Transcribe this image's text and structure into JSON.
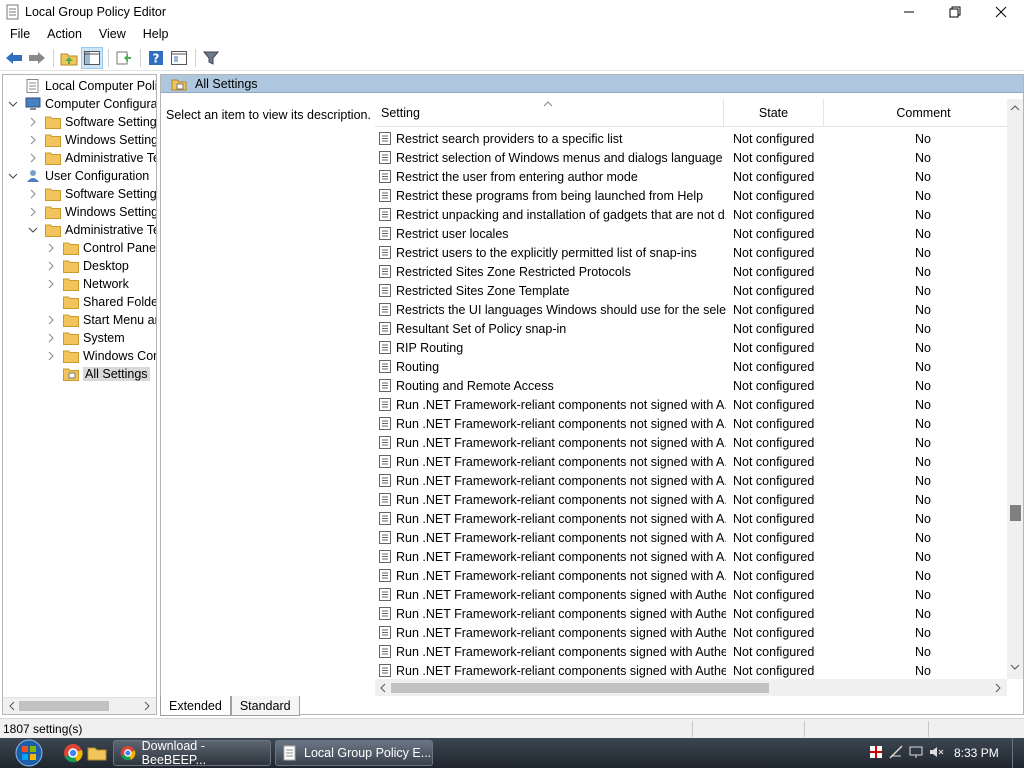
{
  "window": {
    "title": "Local Group Policy Editor"
  },
  "menu": [
    "File",
    "Action",
    "View",
    "Help"
  ],
  "tree": {
    "items": [
      {
        "label": "Local Computer Policy",
        "level": 0,
        "expander": "",
        "icon": "policy-icon"
      },
      {
        "label": "Computer Configuration",
        "level": 0,
        "expander": "open",
        "icon": "computer-icon"
      },
      {
        "label": "Software Settings",
        "level": 1,
        "expander": "closed",
        "icon": "folder-icon"
      },
      {
        "label": "Windows Settings",
        "level": 1,
        "expander": "closed",
        "icon": "folder-icon"
      },
      {
        "label": "Administrative Templates",
        "level": 1,
        "expander": "closed",
        "icon": "folder-icon"
      },
      {
        "label": "User Configuration",
        "level": 0,
        "expander": "open",
        "icon": "user-icon"
      },
      {
        "label": "Software Settings",
        "level": 1,
        "expander": "closed",
        "icon": "folder-icon"
      },
      {
        "label": "Windows Settings",
        "level": 1,
        "expander": "closed",
        "icon": "folder-icon"
      },
      {
        "label": "Administrative Templates",
        "level": 1,
        "expander": "open",
        "icon": "folder-icon"
      },
      {
        "label": "Control Panel",
        "level": 2,
        "expander": "closed",
        "icon": "folder-icon"
      },
      {
        "label": "Desktop",
        "level": 2,
        "expander": "closed",
        "icon": "folder-icon"
      },
      {
        "label": "Network",
        "level": 2,
        "expander": "closed",
        "icon": "folder-icon"
      },
      {
        "label": "Shared Folders",
        "level": 2,
        "expander": "",
        "icon": "folder-icon"
      },
      {
        "label": "Start Menu and Taskbar",
        "level": 2,
        "expander": "closed",
        "icon": "folder-icon"
      },
      {
        "label": "System",
        "level": 2,
        "expander": "closed",
        "icon": "folder-icon"
      },
      {
        "label": "Windows Components",
        "level": 2,
        "expander": "closed",
        "icon": "folder-icon"
      },
      {
        "label": "All Settings",
        "level": 2,
        "expander": "",
        "icon": "all-settings-icon",
        "selected": true
      }
    ]
  },
  "pane": {
    "header": "All Settings",
    "description": "Select an item to view its description."
  },
  "list": {
    "columns": {
      "setting": "Setting",
      "state": "State",
      "comment": "Comment"
    },
    "rows": [
      {
        "name": "Restrict search providers to a specific list",
        "state": "Not configured",
        "comment": "No"
      },
      {
        "name": "Restrict selection of Windows menus and dialogs language",
        "state": "Not configured",
        "comment": "No"
      },
      {
        "name": "Restrict the user from entering author mode",
        "state": "Not configured",
        "comment": "No"
      },
      {
        "name": "Restrict these programs from being launched from Help",
        "state": "Not configured",
        "comment": "No"
      },
      {
        "name": "Restrict unpacking and installation of gadgets that are not d...",
        "state": "Not configured",
        "comment": "No"
      },
      {
        "name": "Restrict user locales",
        "state": "Not configured",
        "comment": "No"
      },
      {
        "name": "Restrict users to the explicitly permitted list of snap-ins",
        "state": "Not configured",
        "comment": "No"
      },
      {
        "name": "Restricted Sites Zone Restricted Protocols",
        "state": "Not configured",
        "comment": "No"
      },
      {
        "name": "Restricted Sites Zone Template",
        "state": "Not configured",
        "comment": "No"
      },
      {
        "name": "Restricts the UI languages Windows should use for the selec...",
        "state": "Not configured",
        "comment": "No"
      },
      {
        "name": "Resultant Set of Policy snap-in",
        "state": "Not configured",
        "comment": "No"
      },
      {
        "name": "RIP Routing",
        "state": "Not configured",
        "comment": "No"
      },
      {
        "name": "Routing",
        "state": "Not configured",
        "comment": "No"
      },
      {
        "name": "Routing and Remote Access",
        "state": "Not configured",
        "comment": "No"
      },
      {
        "name": "Run .NET Framework-reliant components not signed with A...",
        "state": "Not configured",
        "comment": "No"
      },
      {
        "name": "Run .NET Framework-reliant components not signed with A...",
        "state": "Not configured",
        "comment": "No"
      },
      {
        "name": "Run .NET Framework-reliant components not signed with A...",
        "state": "Not configured",
        "comment": "No"
      },
      {
        "name": "Run .NET Framework-reliant components not signed with A...",
        "state": "Not configured",
        "comment": "No"
      },
      {
        "name": "Run .NET Framework-reliant components not signed with A...",
        "state": "Not configured",
        "comment": "No"
      },
      {
        "name": "Run .NET Framework-reliant components not signed with A...",
        "state": "Not configured",
        "comment": "No"
      },
      {
        "name": "Run .NET Framework-reliant components not signed with A...",
        "state": "Not configured",
        "comment": "No"
      },
      {
        "name": "Run .NET Framework-reliant components not signed with A...",
        "state": "Not configured",
        "comment": "No"
      },
      {
        "name": "Run .NET Framework-reliant components not signed with A...",
        "state": "Not configured",
        "comment": "No"
      },
      {
        "name": "Run .NET Framework-reliant components not signed with A...",
        "state": "Not configured",
        "comment": "No"
      },
      {
        "name": "Run .NET Framework-reliant components signed with Authe...",
        "state": "Not configured",
        "comment": "No"
      },
      {
        "name": "Run .NET Framework-reliant components signed with Authe...",
        "state": "Not configured",
        "comment": "No"
      },
      {
        "name": "Run .NET Framework-reliant components signed with Authe...",
        "state": "Not configured",
        "comment": "No"
      },
      {
        "name": "Run .NET Framework-reliant components signed with Authe...",
        "state": "Not configured",
        "comment": "No"
      },
      {
        "name": "Run .NET Framework-reliant components signed with Authe...",
        "state": "Not configured",
        "comment": "No"
      }
    ]
  },
  "tabs": [
    "Extended",
    "Standard"
  ],
  "status": {
    "count": "1807 setting(s)"
  },
  "taskbar": {
    "tasks": [
      {
        "label": "Download - BeeBEEP...",
        "icon": "chrome-icon"
      },
      {
        "label": "Local Group Policy E...",
        "icon": "policy-icon"
      }
    ],
    "clock": "8:33 PM"
  },
  "colors": {
    "pane_header": "#aec7de",
    "selection": "#d9d9d9",
    "folder": "#f2c55c",
    "toolbar_green": "#4caf50",
    "toolbar_blue": "#2f6fc1",
    "taskbar": "#2a323c"
  }
}
